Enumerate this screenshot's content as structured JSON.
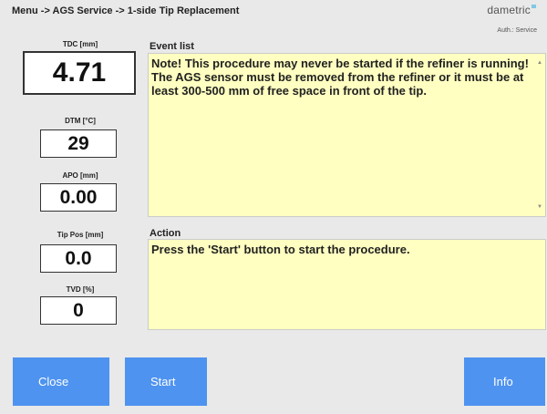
{
  "header": {
    "breadcrumb": "Menu -> AGS Service -> 1-side Tip Replacement",
    "brand": "dametric",
    "auth": "Auth.: Service"
  },
  "measurements": [
    {
      "label": "TDC [mm]",
      "value": "4.71"
    },
    {
      "label": "DTM [°C]",
      "value": "29"
    },
    {
      "label": "APO [mm]",
      "value": "0.00"
    },
    {
      "label": "Tip Pos [mm]",
      "value": "0.0"
    },
    {
      "label": "TVD [%]",
      "value": "0"
    }
  ],
  "event_list": {
    "title": "Event list",
    "lines": [
      "Note! This procedure may never be started if the refiner is running!",
      "The AGS sensor must be removed from the refiner or it must be at least 300-500 mm of free space in front of the tip."
    ]
  },
  "action": {
    "title": "Action",
    "text": "Press the 'Start' button to start the procedure."
  },
  "buttons": {
    "close": "Close",
    "start": "Start",
    "info": "Info"
  },
  "colors": {
    "button": "#4e93f0",
    "panel": "#ffffc1",
    "background": "#e9e9e9"
  }
}
